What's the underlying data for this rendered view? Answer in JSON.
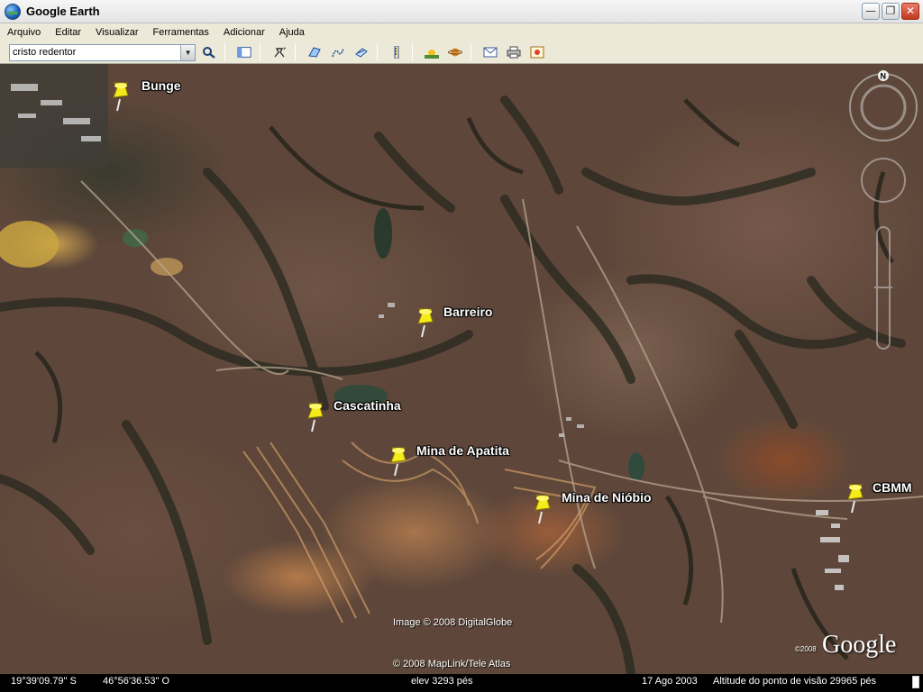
{
  "window": {
    "title": "Google Earth",
    "icon": "google-earth-icon",
    "controls": [
      "minimize-icon",
      "restore-icon",
      "close-icon"
    ]
  },
  "menu": {
    "items": [
      "Arquivo",
      "Editar",
      "Visualizar",
      "Ferramentas",
      "Adicionar",
      "Ajuda"
    ]
  },
  "toolbar": {
    "search_value": "cristo redentor",
    "buttons": [
      "search-icon",
      "sidebar-toggle-icon",
      "add-placemark-icon",
      "add-polygon-icon",
      "add-path-icon",
      "add-image-overlay-icon",
      "ruler-icon",
      "sunlight-icon",
      "planets-icon",
      "email-icon",
      "print-icon",
      "view-in-maps-icon"
    ]
  },
  "placemarks": [
    {
      "label": "Bunge"
    },
    {
      "label": "Barreiro"
    },
    {
      "label": "Cascatinha"
    },
    {
      "label": "Mina de Apatita"
    },
    {
      "label": "Mina de Nióbio"
    },
    {
      "label": "CBMM"
    }
  ],
  "navigation": {
    "north_label": "N"
  },
  "credits": {
    "imagery": "Image © 2008 DigitalGlobe",
    "map": "© 2008 MapLink/Tele Atlas",
    "logo_year": "©2008",
    "logo": "Google"
  },
  "status": {
    "latitude": "19°39'09.79\" S",
    "longitude": "46°56'36.53\" O",
    "elevation": "elev  3293 pés",
    "imagery_date": "17 Ago 2003",
    "eye_altitude": "Altitude do ponto de visão    29965 pés"
  }
}
